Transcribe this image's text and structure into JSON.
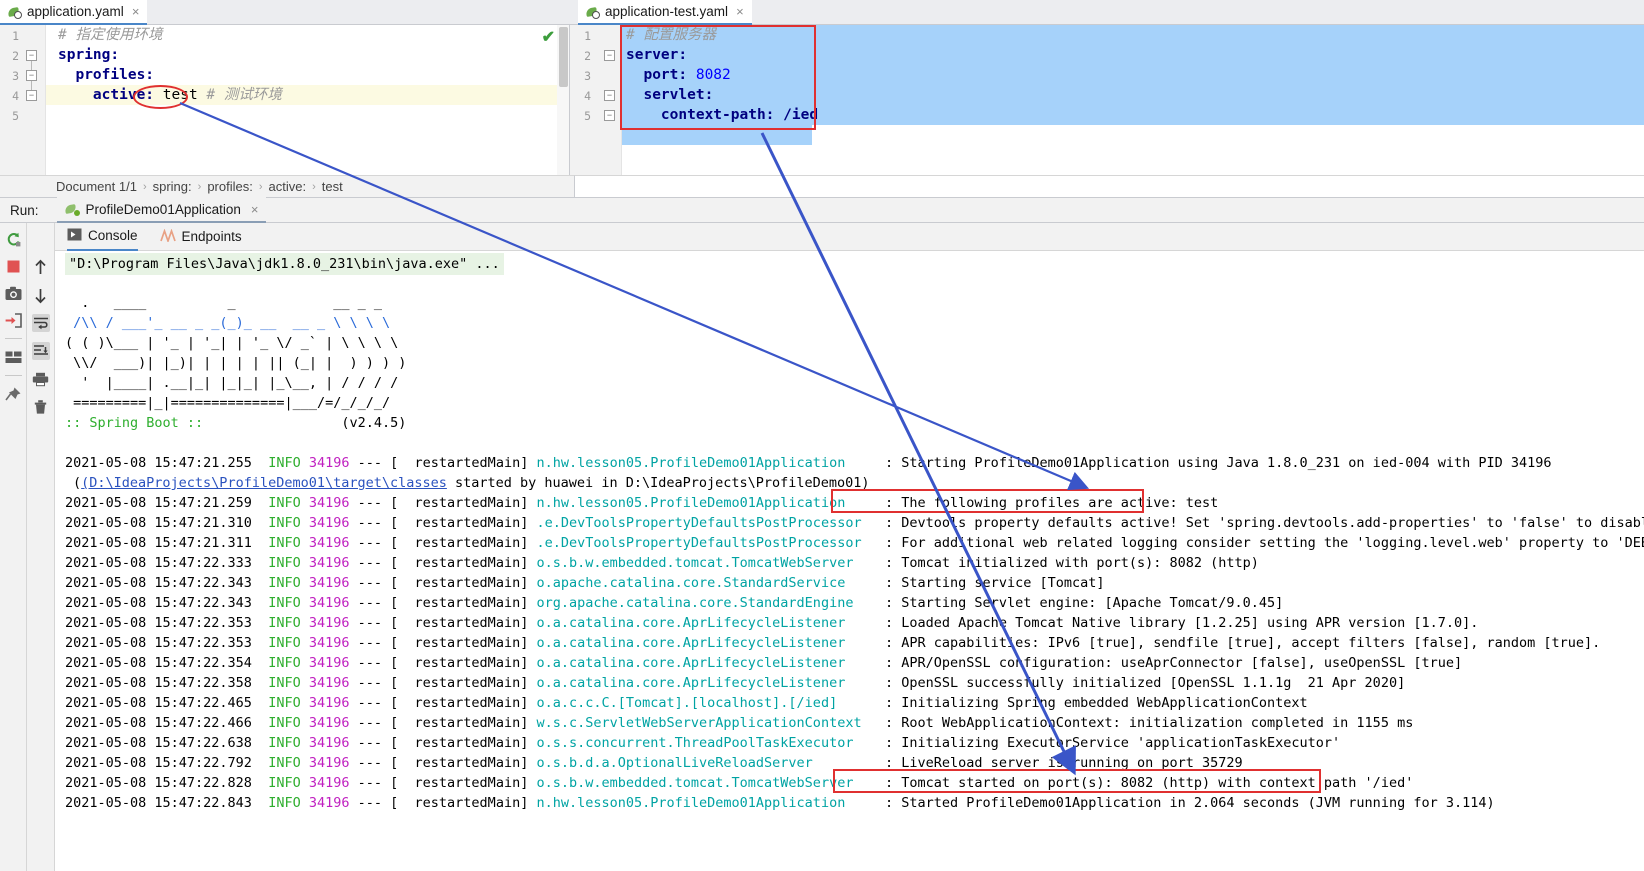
{
  "editor": {
    "tabs": [
      {
        "label": "application.yaml",
        "icon": "spring-leaf-icon",
        "close": "×",
        "active": true
      },
      {
        "label": "application-test.yaml",
        "icon": "spring-leaf-icon",
        "close": "×",
        "active": true
      }
    ],
    "left_file": {
      "name": "application.yaml",
      "line_numbers": [
        "1",
        "2",
        "3",
        "4",
        "5"
      ],
      "lines": [
        {
          "indent": "",
          "comment": "# 指定使用环境"
        },
        {
          "key": "spring:",
          "indent": ""
        },
        {
          "key": "profiles:",
          "indent": "  "
        },
        {
          "key": "active:",
          "value": "test",
          "indent": "    ",
          "comment": "# 测试环境"
        },
        {
          "key": "",
          "indent": ""
        }
      ],
      "raw_text_line1": "# 指定使用环境",
      "raw_text_line2": "spring:",
      "raw_text_line3": "  profiles:",
      "raw_text_line4_key": "    active: ",
      "raw_text_line4_val": "test",
      "raw_text_line4_comment": " # 测试环境",
      "inspection_ok": "✔"
    },
    "right_file": {
      "name": "application-test.yaml",
      "line_numbers": [
        "1",
        "2",
        "3",
        "4",
        "5"
      ],
      "raw_text_line1": "# 配置服务器",
      "raw_text_line2": "server:",
      "raw_text_line3": "  port: ",
      "raw_text_line3_val": "8082",
      "raw_text_line4": "  servlet:",
      "raw_text_line5_key": "    context-path: ",
      "raw_text_line5_val": "/ied"
    }
  },
  "breadcrumb": {
    "items": [
      "Document 1/1",
      "spring:",
      "profiles:",
      "active:",
      "test"
    ],
    "separator": "›"
  },
  "run_panel": {
    "run_label": "Run:",
    "configuration": "ProfileDemo01Application",
    "close": "×",
    "tabs": [
      {
        "label": "Console",
        "icon": "console-icon",
        "active": true
      },
      {
        "label": "Endpoints",
        "icon": "endpoints-icon",
        "active": false
      }
    ],
    "toolbar_left_icons": [
      "rerun-icon",
      "stop-icon",
      "camera-icon",
      "export-icon",
      "layout-icon",
      "pin-icon"
    ],
    "toolbar_second_icons": [
      "up-arrow-icon",
      "down-arrow-icon",
      "soft-wrap-icon",
      "scroll-to-end-icon",
      "print-icon",
      "trash-icon"
    ]
  },
  "console": {
    "command_line": "\"D:\\Program Files\\Java\\jdk1.8.0_231\\bin\\java.exe\" ...",
    "banner": [
      "  .   ____          _            __ _ _",
      " /\\\\ / ___'_ __ _ _(_)_ __  __ _ \\ \\ \\ \\",
      "( ( )\\___ | '_ | '_| | '_ \\/ _` | \\ \\ \\ \\",
      " \\\\/  ___)| |_)| | | | | || (_| |  ) ) ) )",
      "  '  |____| .__|_| |_|_| |_\\__, | / / / /",
      " =========|_|==============|___/=/_/_/_/"
    ],
    "banner_brand": ":: Spring Boot ::",
    "banner_version": "(v2.4.5)",
    "log_lines": [
      {
        "time": "2021-05-08 15:47:21.255",
        "level": "INFO",
        "pid": "34196",
        "sep": "--- [",
        "thread": "  restartedMain]",
        "logger": "n.hw.lesson05.ProfileDemo01Application",
        "colon": ":",
        "message": "Starting ProfileDemo01Application using Java 1.8.0_231 on ied-004 with PID 34196"
      },
      {
        "continuation": true,
        "link": "(D:\\IdeaProjects\\ProfileDemo01\\target\\classes",
        "message": " started by huawei in D:\\IdeaProjects\\ProfileDemo01)"
      },
      {
        "time": "2021-05-08 15:47:21.259",
        "level": "INFO",
        "pid": "34196",
        "sep": "--- [",
        "thread": "  restartedMain]",
        "logger": "n.hw.lesson05.ProfileDemo01Application",
        "colon": ":",
        "message": "The following profiles are active: test",
        "highlight": true
      },
      {
        "time": "2021-05-08 15:47:21.310",
        "level": "INFO",
        "pid": "34196",
        "sep": "--- [",
        "thread": "  restartedMain]",
        "logger": ".e.DevToolsPropertyDefaultsPostProcessor",
        "colon": ":",
        "message": "Devtools property defaults active! Set 'spring.devtools.add-properties' to 'false' to disable"
      },
      {
        "time": "2021-05-08 15:47:21.311",
        "level": "INFO",
        "pid": "34196",
        "sep": "--- [",
        "thread": "  restartedMain]",
        "logger": ".e.DevToolsPropertyDefaultsPostProcessor",
        "colon": ":",
        "message": "For additional web related logging consider setting the 'logging.level.web' property to 'DEBUG'"
      },
      {
        "time": "2021-05-08 15:47:22.333",
        "level": "INFO",
        "pid": "34196",
        "sep": "--- [",
        "thread": "  restartedMain]",
        "logger": "o.s.b.w.embedded.tomcat.TomcatWebServer",
        "colon": ":",
        "message": "Tomcat initialized with port(s): 8082 (http)"
      },
      {
        "time": "2021-05-08 15:47:22.343",
        "level": "INFO",
        "pid": "34196",
        "sep": "--- [",
        "thread": "  restartedMain]",
        "logger": "o.apache.catalina.core.StandardService",
        "colon": ":",
        "message": "Starting service [Tomcat]"
      },
      {
        "time": "2021-05-08 15:47:22.343",
        "level": "INFO",
        "pid": "34196",
        "sep": "--- [",
        "thread": "  restartedMain]",
        "logger": "org.apache.catalina.core.StandardEngine",
        "colon": ":",
        "message": "Starting Servlet engine: [Apache Tomcat/9.0.45]"
      },
      {
        "time": "2021-05-08 15:47:22.353",
        "level": "INFO",
        "pid": "34196",
        "sep": "--- [",
        "thread": "  restartedMain]",
        "logger": "o.a.catalina.core.AprLifecycleListener",
        "colon": ":",
        "message": "Loaded Apache Tomcat Native library [1.2.25] using APR version [1.7.0]."
      },
      {
        "time": "2021-05-08 15:47:22.353",
        "level": "INFO",
        "pid": "34196",
        "sep": "--- [",
        "thread": "  restartedMain]",
        "logger": "o.a.catalina.core.AprLifecycleListener",
        "colon": ":",
        "message": "APR capabilities: IPv6 [true], sendfile [true], accept filters [false], random [true]."
      },
      {
        "time": "2021-05-08 15:47:22.354",
        "level": "INFO",
        "pid": "34196",
        "sep": "--- [",
        "thread": "  restartedMain]",
        "logger": "o.a.catalina.core.AprLifecycleListener",
        "colon": ":",
        "message": "APR/OpenSSL configuration: useAprConnector [false], useOpenSSL [true]"
      },
      {
        "time": "2021-05-08 15:47:22.358",
        "level": "INFO",
        "pid": "34196",
        "sep": "--- [",
        "thread": "  restartedMain]",
        "logger": "o.a.catalina.core.AprLifecycleListener",
        "colon": ":",
        "message": "OpenSSL successfully initialized [OpenSSL 1.1.1g  21 Apr 2020]"
      },
      {
        "time": "2021-05-08 15:47:22.465",
        "level": "INFO",
        "pid": "34196",
        "sep": "--- [",
        "thread": "  restartedMain]",
        "logger": "o.a.c.c.C.[Tomcat].[localhost].[/ied]",
        "colon": ":",
        "message": "Initializing Spring embedded WebApplicationContext"
      },
      {
        "time": "2021-05-08 15:47:22.466",
        "level": "INFO",
        "pid": "34196",
        "sep": "--- [",
        "thread": "  restartedMain]",
        "logger": "w.s.c.ServletWebServerApplicationContext",
        "colon": ":",
        "message": "Root WebApplicationContext: initialization completed in 1155 ms"
      },
      {
        "time": "2021-05-08 15:47:22.638",
        "level": "INFO",
        "pid": "34196",
        "sep": "--- [",
        "thread": "  restartedMain]",
        "logger": "o.s.s.concurrent.ThreadPoolTaskExecutor",
        "colon": ":",
        "message": "Initializing ExecutorService 'applicationTaskExecutor'"
      },
      {
        "time": "2021-05-08 15:47:22.792",
        "level": "INFO",
        "pid": "34196",
        "sep": "--- [",
        "thread": "  restartedMain]",
        "logger": "o.s.b.d.a.OptionalLiveReloadServer",
        "colon": ":",
        "message": "LiveReload server is running on port 35729"
      },
      {
        "time": "2021-05-08 15:47:22.828",
        "level": "INFO",
        "pid": "34196",
        "sep": "--- [",
        "thread": "  restartedMain]",
        "logger": "o.s.b.w.embedded.tomcat.TomcatWebServer",
        "colon": ":",
        "message": "Tomcat started on port(s): 8082 (http) with context path '/ied'",
        "highlight": true
      },
      {
        "time": "2021-05-08 15:47:22.843",
        "level": "INFO",
        "pid": "34196",
        "sep": "--- [",
        "thread": "  restartedMain]",
        "logger": "n.hw.lesson05.ProfileDemo01Application",
        "colon": ":",
        "message": "Started ProfileDemo01Application in 2.064 seconds (JVM running for 3.114)"
      }
    ]
  },
  "annotations": {
    "highlight_color": "#e03030",
    "arrow_color": "#3a55c8",
    "ellipse_target": "test",
    "boxes": [
      "application-test-yaml-code-box",
      "active-profiles-log-box",
      "tomcat-started-log-box"
    ]
  },
  "colors": {
    "accent": "#4a86c8",
    "selection": "#a6d2fa",
    "annotation_red": "#e03030",
    "arrow_blue": "#3a55c8",
    "info_green": "#2eae2e",
    "logger_cyan": "#00a3a3",
    "pid_magenta": "#c020c0"
  }
}
